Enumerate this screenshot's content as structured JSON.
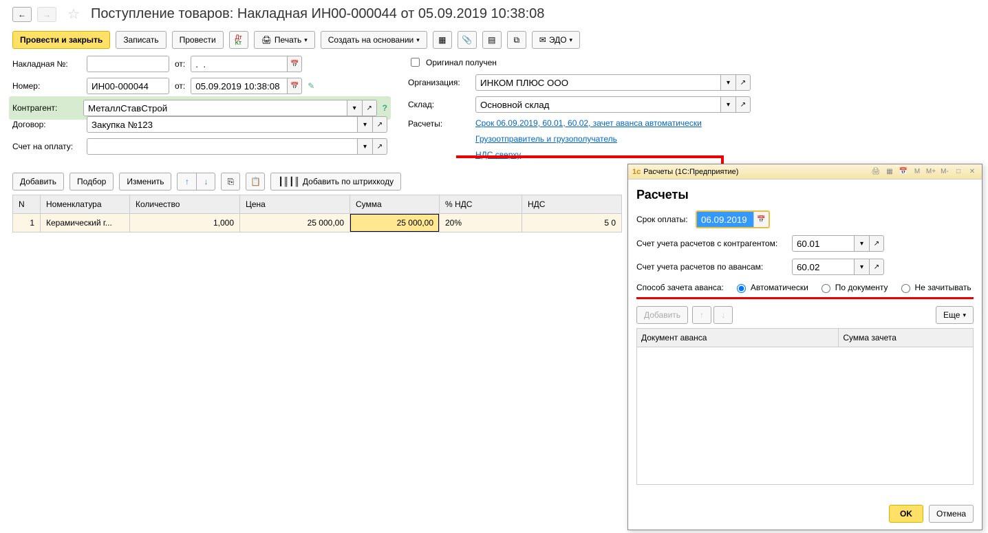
{
  "header": {
    "title": "Поступление товаров: Накладная ИН00-000044 от 05.09.2019 10:38:08"
  },
  "toolbar": {
    "post_close": "Провести и закрыть",
    "save": "Записать",
    "post": "Провести",
    "print": "Печать",
    "create_based": "Создать на основании",
    "edo": "ЭДО"
  },
  "form": {
    "invoice_no_label": "Накладная №:",
    "invoice_no": "",
    "from1": "от:",
    "invoice_date": ".  .",
    "number_label": "Номер:",
    "number": "ИН00-000044",
    "from2": "от:",
    "date": "05.09.2019 10:38:08",
    "counterparty_label": "Контрагент:",
    "counterparty": "МеталлСтавСтрой",
    "contract_label": "Договор:",
    "contract": "Закупка №123",
    "invoice_pay_label": "Счет на оплату:",
    "invoice_pay": "",
    "original_received": "Оригинал получен",
    "org_label": "Организация:",
    "org": "ИНКОМ ПЛЮС ООО",
    "warehouse_label": "Склад:",
    "warehouse": "Основной склад",
    "settlements_label": "Расчеты:",
    "settlements_link": "Срок 06.09.2019, 60.01, 60.02, зачет аванса автоматически",
    "shipper_link": "Грузоотправитель и грузополучатель",
    "vat_link": "НДС сверху"
  },
  "table_toolbar": {
    "add": "Добавить",
    "pick": "Подбор",
    "edit": "Изменить",
    "barcode": "Добавить по штрихкоду"
  },
  "table": {
    "headers": {
      "n": "N",
      "item": "Номенклатура",
      "qty": "Количество",
      "price": "Цена",
      "sum": "Сумма",
      "vat_rate": "% НДС",
      "vat": "НДС"
    },
    "rows": [
      {
        "n": "1",
        "item": "Керамический г...",
        "qty": "1,000",
        "price": "25 000,00",
        "sum": "25 000,00",
        "vat_rate": "20%",
        "vat": "5 0"
      }
    ]
  },
  "popup": {
    "titlebar": "Расчеты  (1С:Предприятие)",
    "title": "Расчеты",
    "due_label": "Срок оплаты:",
    "due_date": "06.09.2019",
    "acct_cp_label": "Счет учета расчетов с контрагентом:",
    "acct_cp": "60.01",
    "acct_adv_label": "Счет учета расчетов по авансам:",
    "acct_adv": "60.02",
    "advance_mode_label": "Способ зачета аванса:",
    "mode_auto": "Автоматически",
    "mode_doc": "По документу",
    "mode_none": "Не зачитывать",
    "add": "Добавить",
    "more": "Еще",
    "col_doc": "Документ аванса",
    "col_sum": "Сумма зачета",
    "ok": "OK",
    "cancel": "Отмена"
  }
}
